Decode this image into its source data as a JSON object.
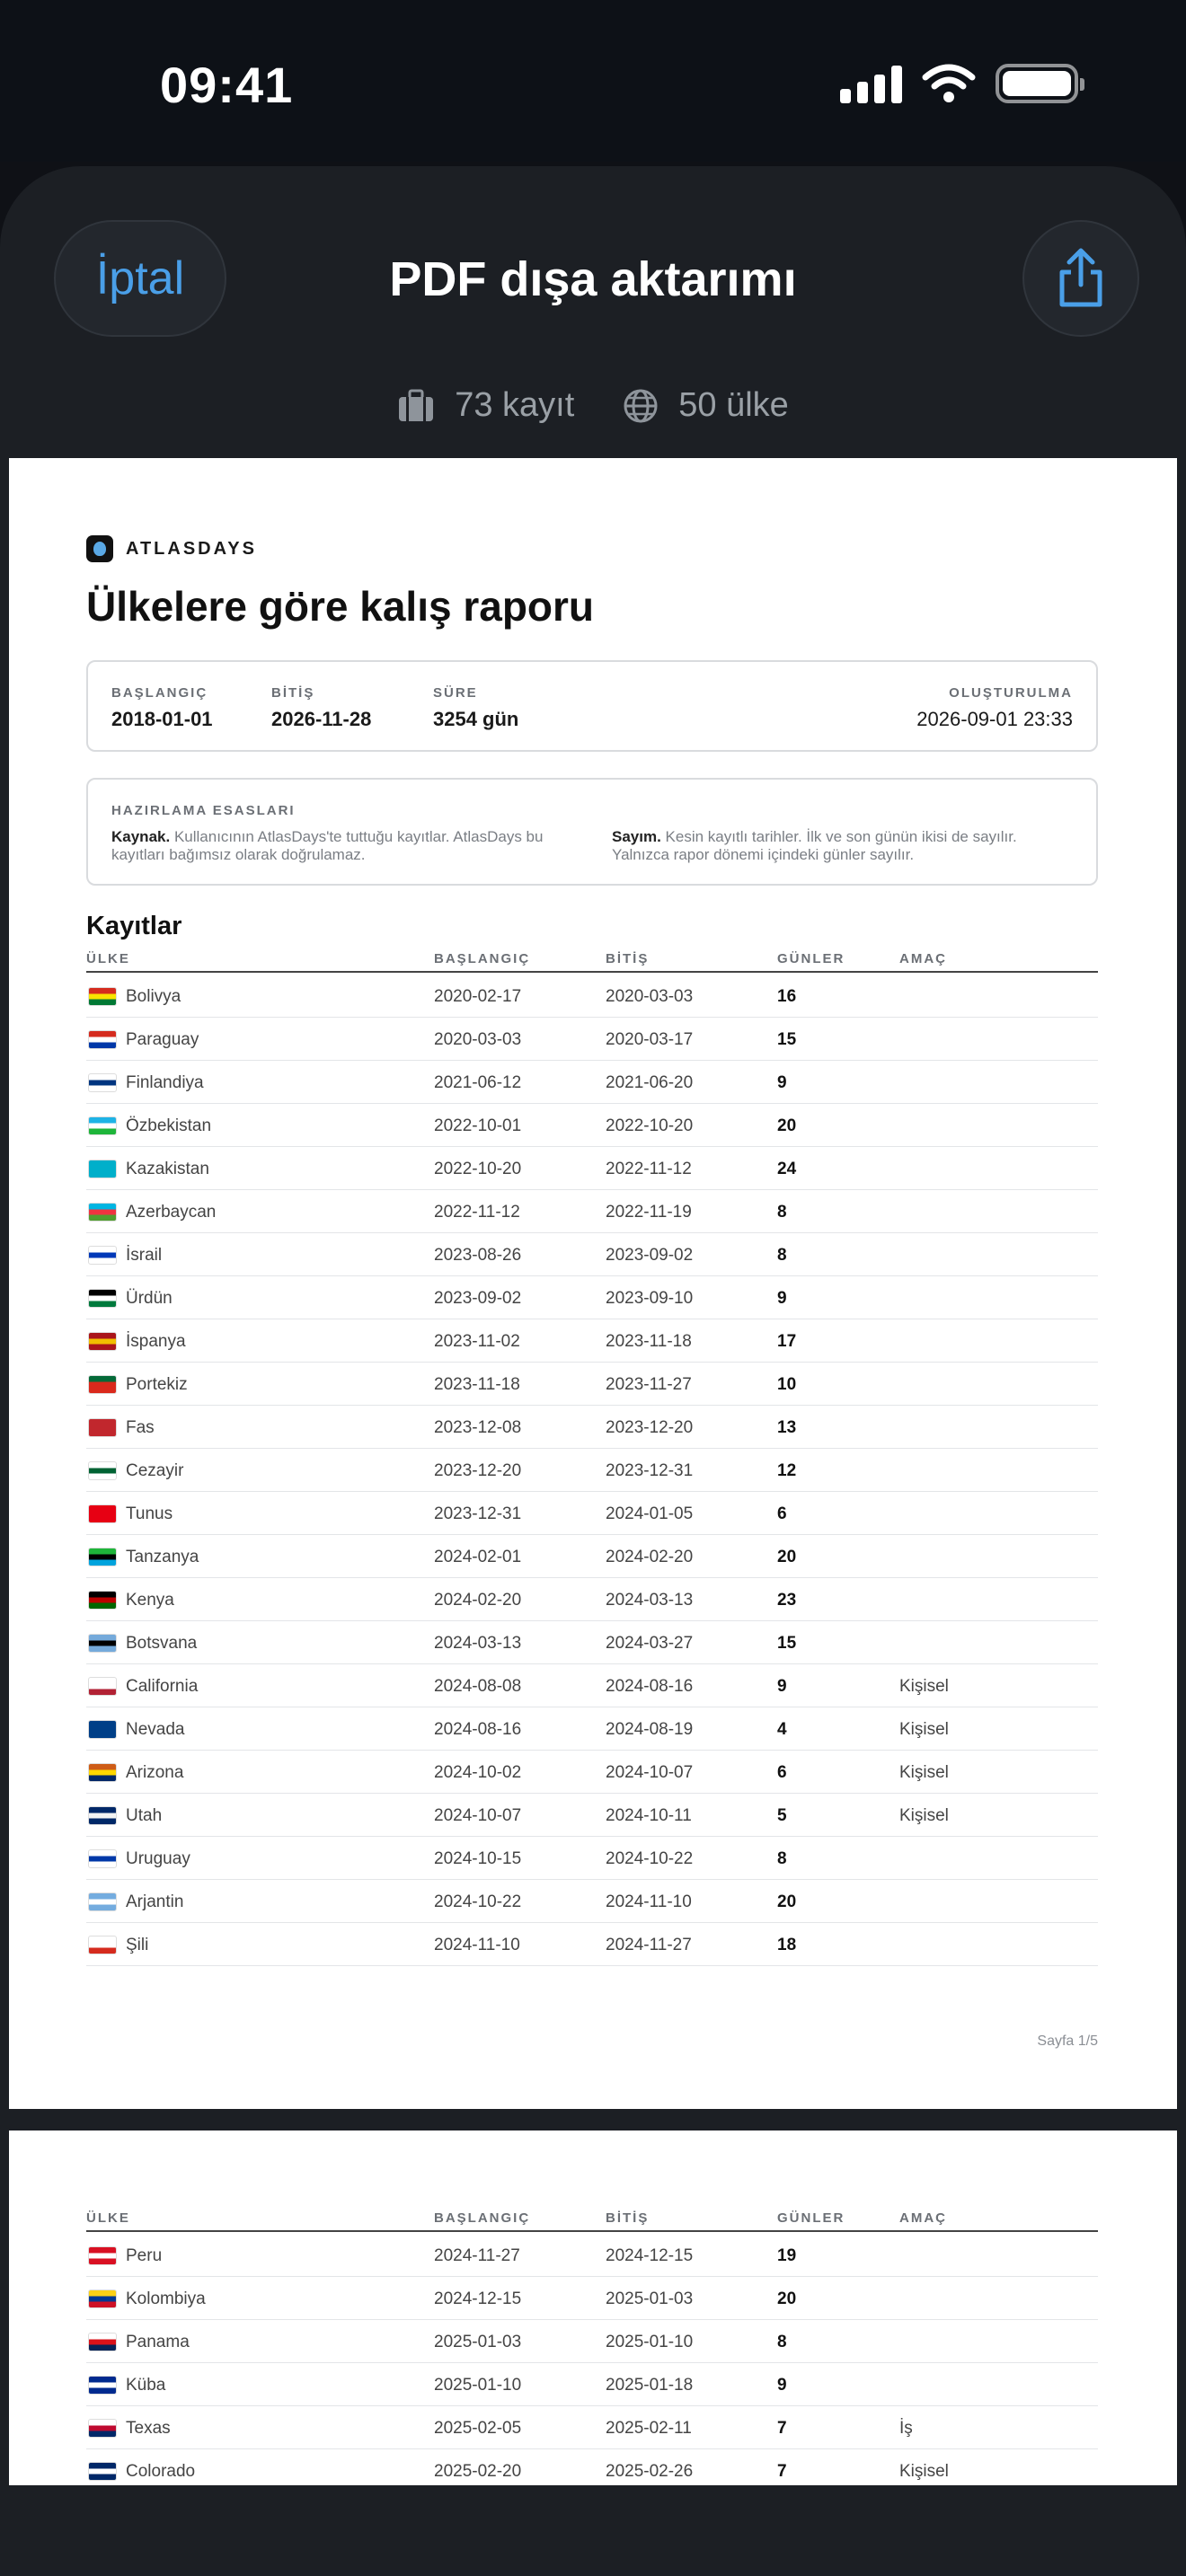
{
  "status": {
    "time": "09:41"
  },
  "sheet": {
    "cancel_label": "İptal",
    "title": "PDF dışa aktarımı",
    "share_icon": "share-icon",
    "records_summary": "73 kayıt",
    "countries_summary": "50 ülke"
  },
  "report": {
    "brand": "ATLASDAYS",
    "title": "Ülkelere göre kalış raporu",
    "meta": {
      "start_label": "BAŞLANGIÇ",
      "start_value": "2018-01-01",
      "end_label": "BİTİŞ",
      "end_value": "2026-11-28",
      "duration_label": "SÜRE",
      "duration_value": "3254 gün",
      "created_label": "OLUŞTURULMA",
      "created_value": "2026-09-01 23:33"
    },
    "basis": {
      "label": "HAZIRLAMA ESASLARI",
      "source_title": "Kaynak.",
      "source_text": "Kullanıcının AtlasDays'te tuttuğu kayıtlar. AtlasDays bu kayıtları bağımsız olarak doğrulamaz.",
      "count_title": "Sayım.",
      "count_text": "Kesin kayıtlı tarihler. İlk ve son günün ikisi de sayılır. Yalnızca rapor dönemi içindeki günler sayılır."
    },
    "records_title": "Kayıtlar",
    "columns": {
      "country": "ÜLKE",
      "start": "BAŞLANGIÇ",
      "end": "BİTİŞ",
      "days": "GÜNLER",
      "purpose": "AMAÇ"
    },
    "page_number": "Sayfa 1/5",
    "rows_page1": [
      {
        "country": "Bolivya",
        "start": "2020-02-17",
        "end": "2020-03-03",
        "days": "16",
        "purpose": "",
        "flag": [
          "#d52b1e",
          "#f9e300",
          "#007934"
        ]
      },
      {
        "country": "Paraguay",
        "start": "2020-03-03",
        "end": "2020-03-17",
        "days": "15",
        "purpose": "",
        "flag": [
          "#d52b1e",
          "#ffffff",
          "#0038a8"
        ]
      },
      {
        "country": "Finlandiya",
        "start": "2021-06-12",
        "end": "2021-06-20",
        "days": "9",
        "purpose": "",
        "flag": [
          "#ffffff",
          "#003580",
          "#ffffff"
        ]
      },
      {
        "country": "Özbekistan",
        "start": "2022-10-01",
        "end": "2022-10-20",
        "days": "20",
        "purpose": "",
        "flag": [
          "#1eb3e6",
          "#ffffff",
          "#1eb53a"
        ]
      },
      {
        "country": "Kazakistan",
        "start": "2022-10-20",
        "end": "2022-11-12",
        "days": "24",
        "purpose": "",
        "flag": [
          "#00afca",
          "#00afca",
          "#00afca"
        ]
      },
      {
        "country": "Azerbaycan",
        "start": "2022-11-12",
        "end": "2022-11-19",
        "days": "8",
        "purpose": "",
        "flag": [
          "#00b5e2",
          "#ef3340",
          "#509e2f"
        ]
      },
      {
        "country": "İsrail",
        "start": "2023-08-26",
        "end": "2023-09-02",
        "days": "8",
        "purpose": "",
        "flag": [
          "#ffffff",
          "#0038b8",
          "#ffffff"
        ]
      },
      {
        "country": "Ürdün",
        "start": "2023-09-02",
        "end": "2023-09-10",
        "days": "9",
        "purpose": "",
        "flag": [
          "#000000",
          "#ffffff",
          "#007a3d"
        ]
      },
      {
        "country": "İspanya",
        "start": "2023-11-02",
        "end": "2023-11-18",
        "days": "17",
        "purpose": "",
        "flag": [
          "#aa151b",
          "#f1bf00",
          "#aa151b"
        ]
      },
      {
        "country": "Portekiz",
        "start": "2023-11-18",
        "end": "2023-11-27",
        "days": "10",
        "purpose": "",
        "flag": [
          "#046a38",
          "#da291c",
          "#da291c"
        ]
      },
      {
        "country": "Fas",
        "start": "2023-12-08",
        "end": "2023-12-20",
        "days": "13",
        "purpose": "",
        "flag": [
          "#c1272d",
          "#c1272d",
          "#c1272d"
        ]
      },
      {
        "country": "Cezayir",
        "start": "2023-12-20",
        "end": "2023-12-31",
        "days": "12",
        "purpose": "",
        "flag": [
          "#ffffff",
          "#006233",
          "#ffffff"
        ]
      },
      {
        "country": "Tunus",
        "start": "2023-12-31",
        "end": "2024-01-05",
        "days": "6",
        "purpose": "",
        "flag": [
          "#e70013",
          "#e70013",
          "#e70013"
        ]
      },
      {
        "country": "Tanzanya",
        "start": "2024-02-01",
        "end": "2024-02-20",
        "days": "20",
        "purpose": "",
        "flag": [
          "#1eb53a",
          "#000000",
          "#00a3dd"
        ]
      },
      {
        "country": "Kenya",
        "start": "2024-02-20",
        "end": "2024-03-13",
        "days": "23",
        "purpose": "",
        "flag": [
          "#000000",
          "#bb0000",
          "#006600"
        ]
      },
      {
        "country": "Botsvana",
        "start": "2024-03-13",
        "end": "2024-03-27",
        "days": "15",
        "purpose": "",
        "flag": [
          "#75aadb",
          "#000000",
          "#75aadb"
        ]
      },
      {
        "country": "California",
        "start": "2024-08-08",
        "end": "2024-08-16",
        "days": "9",
        "purpose": "Kişisel",
        "flag": [
          "#ffffff",
          "#ffffff",
          "#b22234"
        ]
      },
      {
        "country": "Nevada",
        "start": "2024-08-16",
        "end": "2024-08-19",
        "days": "4",
        "purpose": "Kişisel",
        "flag": [
          "#003f87",
          "#003f87",
          "#003f87"
        ]
      },
      {
        "country": "Arizona",
        "start": "2024-10-02",
        "end": "2024-10-07",
        "days": "6",
        "purpose": "Kişisel",
        "flag": [
          "#ce5c17",
          "#fed700",
          "#002868"
        ]
      },
      {
        "country": "Utah",
        "start": "2024-10-07",
        "end": "2024-10-11",
        "days": "5",
        "purpose": "Kişisel",
        "flag": [
          "#002868",
          "#f3f3f3",
          "#002868"
        ]
      },
      {
        "country": "Uruguay",
        "start": "2024-10-15",
        "end": "2024-10-22",
        "days": "8",
        "purpose": "",
        "flag": [
          "#ffffff",
          "#0038a8",
          "#ffffff"
        ]
      },
      {
        "country": "Arjantin",
        "start": "2024-10-22",
        "end": "2024-11-10",
        "days": "20",
        "purpose": "",
        "flag": [
          "#74acdf",
          "#ffffff",
          "#74acdf"
        ]
      },
      {
        "country": "Şili",
        "start": "2024-11-10",
        "end": "2024-11-27",
        "days": "18",
        "purpose": "",
        "flag": [
          "#ffffff",
          "#ffffff",
          "#d52b1e"
        ]
      }
    ],
    "rows_page2": [
      {
        "country": "Peru",
        "start": "2024-11-27",
        "end": "2024-12-15",
        "days": "19",
        "purpose": "",
        "flag": [
          "#d91023",
          "#ffffff",
          "#d91023"
        ]
      },
      {
        "country": "Kolombiya",
        "start": "2024-12-15",
        "end": "2025-01-03",
        "days": "20",
        "purpose": "",
        "flag": [
          "#fcd116",
          "#003893",
          "#ce1126"
        ]
      },
      {
        "country": "Panama",
        "start": "2025-01-03",
        "end": "2025-01-10",
        "days": "8",
        "purpose": "",
        "flag": [
          "#ffffff",
          "#da121a",
          "#072357"
        ]
      },
      {
        "country": "Küba",
        "start": "2025-01-10",
        "end": "2025-01-18",
        "days": "9",
        "purpose": "",
        "flag": [
          "#002a8f",
          "#ffffff",
          "#002a8f"
        ]
      },
      {
        "country": "Texas",
        "start": "2025-02-05",
        "end": "2025-02-11",
        "days": "7",
        "purpose": "İş",
        "flag": [
          "#ffffff",
          "#bf0a30",
          "#002868"
        ]
      },
      {
        "country": "Colorado",
        "start": "2025-02-20",
        "end": "2025-02-26",
        "days": "7",
        "purpose": "Kişisel",
        "flag": [
          "#002868",
          "#ffffff",
          "#002868"
        ]
      }
    ]
  }
}
